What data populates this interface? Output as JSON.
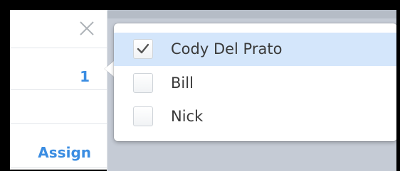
{
  "left_panel": {
    "count": "1",
    "assign_label": "Assign"
  },
  "icons": {
    "close": "close-icon",
    "check": "checkmark-icon"
  },
  "colors": {
    "link": "#3b8de2",
    "selected_row": "#d4e6fb",
    "overlay": "#c5cbd5"
  },
  "assignee_options": [
    {
      "label": "Cody Del Prato",
      "checked": true
    },
    {
      "label": "Bill",
      "checked": false
    },
    {
      "label": "Nick",
      "checked": false
    }
  ]
}
